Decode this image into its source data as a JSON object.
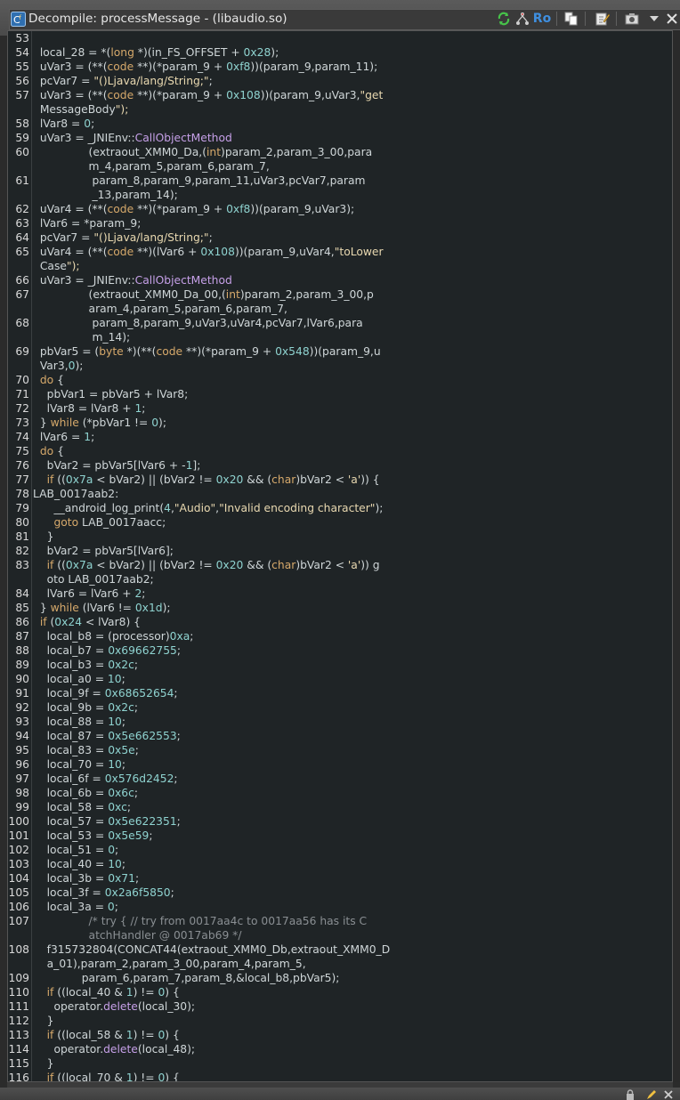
{
  "window": {
    "title": "Decompile: processMessage -  (libaudio.so)",
    "toolbar": {
      "ro_label": "Ro",
      "icons": [
        "refresh-icon",
        "graph-icon",
        "ro-toggle",
        "copy-icon",
        "edit-icon",
        "snapshot-icon",
        "dropdown-icon",
        "close-icon"
      ]
    }
  },
  "code": {
    "lines": [
      {
        "ln": "53",
        "text": ""
      },
      {
        "ln": "54",
        "text": "  local_28 = *(long *)(in_FS_OFFSET + 0x28);"
      },
      {
        "ln": "55",
        "text": "  uVar3 = (**(code **)(*param_9 + 0xf8))(param_9,param_11);"
      },
      {
        "ln": "56",
        "text": "  pcVar7 = \"()Ljava/lang/String;\";"
      },
      {
        "ln": "57",
        "text": "  uVar3 = (**(code **)(*param_9 + 0x108))(param_9,uVar3,\"get"
      },
      {
        "ln": "",
        "text": "  MessageBody\");"
      },
      {
        "ln": "58",
        "text": "  lVar8 = 0;"
      },
      {
        "ln": "59",
        "text": "  uVar3 = _JNIEnv::CallObjectMethod"
      },
      {
        "ln": "60",
        "text": "                (extraout_XMM0_Da,(int)param_2,param_3_00,para"
      },
      {
        "ln": "",
        "text": "                m_4,param_5,param_6,param_7,"
      },
      {
        "ln": "61",
        "text": "                 param_8,param_9,param_11,uVar3,pcVar7,param"
      },
      {
        "ln": "",
        "text": "                 _13,param_14);"
      },
      {
        "ln": "62",
        "text": "  uVar4 = (**(code **)(*param_9 + 0xf8))(param_9,uVar3);"
      },
      {
        "ln": "63",
        "text": "  lVar6 = *param_9;"
      },
      {
        "ln": "64",
        "text": "  pcVar7 = \"()Ljava/lang/String;\";"
      },
      {
        "ln": "65",
        "text": "  uVar4 = (**(code **)(lVar6 + 0x108))(param_9,uVar4,\"toLower"
      },
      {
        "ln": "",
        "text": "  Case\");"
      },
      {
        "ln": "66",
        "text": "  uVar3 = _JNIEnv::CallObjectMethod"
      },
      {
        "ln": "67",
        "text": "                (extraout_XMM0_Da_00,(int)param_2,param_3_00,p"
      },
      {
        "ln": "",
        "text": "                aram_4,param_5,param_6,param_7,"
      },
      {
        "ln": "68",
        "text": "                 param_8,param_9,uVar3,uVar4,pcVar7,lVar6,para"
      },
      {
        "ln": "",
        "text": "                 m_14);"
      },
      {
        "ln": "69",
        "text": "  pbVar5 = (byte *)(**(code **)(*param_9 + 0x548))(param_9,u"
      },
      {
        "ln": "",
        "text": "  Var3,0);"
      },
      {
        "ln": "70",
        "text": "  do {"
      },
      {
        "ln": "71",
        "text": "    pbVar1 = pbVar5 + lVar8;"
      },
      {
        "ln": "72",
        "text": "    lVar8 = lVar8 + 1;"
      },
      {
        "ln": "73",
        "text": "  } while (*pbVar1 != 0);"
      },
      {
        "ln": "74",
        "text": "  lVar6 = 1;"
      },
      {
        "ln": "75",
        "text": "  do {"
      },
      {
        "ln": "76",
        "text": "    bVar2 = pbVar5[lVar6 + -1];"
      },
      {
        "ln": "77",
        "text": "    if ((0x7a < bVar2) || (bVar2 != 0x20 && (char)bVar2 < 'a')) {"
      },
      {
        "ln": "78",
        "text": "LAB_0017aab2:"
      },
      {
        "ln": "79",
        "text": "      __android_log_print(4,\"Audio\",\"Invalid encoding character\");"
      },
      {
        "ln": "80",
        "text": "      goto LAB_0017aacc;"
      },
      {
        "ln": "81",
        "text": "    }"
      },
      {
        "ln": "82",
        "text": "    bVar2 = pbVar5[lVar6];"
      },
      {
        "ln": "83",
        "text": "    if ((0x7a < bVar2) || (bVar2 != 0x20 && (char)bVar2 < 'a')) g"
      },
      {
        "ln": "",
        "text": "    oto LAB_0017aab2;"
      },
      {
        "ln": "84",
        "text": "    lVar6 = lVar6 + 2;"
      },
      {
        "ln": "85",
        "text": "  } while (lVar6 != 0x1d);"
      },
      {
        "ln": "86",
        "text": "  if (0x24 < lVar8) {"
      },
      {
        "ln": "87",
        "text": "    local_b8 = (processor)0xa;"
      },
      {
        "ln": "88",
        "text": "    local_b7 = 0x69662755;"
      },
      {
        "ln": "89",
        "text": "    local_b3 = 0x2c;"
      },
      {
        "ln": "90",
        "text": "    local_a0 = 10;"
      },
      {
        "ln": "91",
        "text": "    local_9f = 0x68652654;"
      },
      {
        "ln": "92",
        "text": "    local_9b = 0x2c;"
      },
      {
        "ln": "93",
        "text": "    local_88 = 10;"
      },
      {
        "ln": "94",
        "text": "    local_87 = 0x5e662553;"
      },
      {
        "ln": "95",
        "text": "    local_83 = 0x5e;"
      },
      {
        "ln": "96",
        "text": "    local_70 = 10;"
      },
      {
        "ln": "97",
        "text": "    local_6f = 0x576d2452;"
      },
      {
        "ln": "98",
        "text": "    local_6b = 0x6c;"
      },
      {
        "ln": "99",
        "text": "    local_58 = 0xc;"
      },
      {
        "ln": "100",
        "text": "    local_57 = 0x5e622351;"
      },
      {
        "ln": "101",
        "text": "    local_53 = 0x5e59;"
      },
      {
        "ln": "102",
        "text": "    local_51 = 0;"
      },
      {
        "ln": "103",
        "text": "    local_40 = 10;"
      },
      {
        "ln": "104",
        "text": "    local_3b = 0x71;"
      },
      {
        "ln": "105",
        "text": "    local_3f = 0x2a6f5850;"
      },
      {
        "ln": "106",
        "text": "    local_3a = 0;"
      },
      {
        "ln": "107",
        "text": "                /* try { // try from 0017aa4c to 0017aa56 has its C"
      },
      {
        "ln": "",
        "text": "                atchHandler @ 0017ab69 */"
      },
      {
        "ln": "108",
        "text": "    f315732804(CONCAT44(extraout_XMM0_Db,extraout_XMM0_D"
      },
      {
        "ln": "",
        "text": "    a_01),param_2,param_3_00,param_4,param_5,"
      },
      {
        "ln": "109",
        "text": "              param_6,param_7,param_8,&local_b8,pbVar5);"
      },
      {
        "ln": "110",
        "text": "    if ((local_40 & 1) != 0) {"
      },
      {
        "ln": "111",
        "text": "      operator.delete(local_30);"
      },
      {
        "ln": "112",
        "text": "    }"
      },
      {
        "ln": "113",
        "text": "    if ((local_58 & 1) != 0) {"
      },
      {
        "ln": "114",
        "text": "      operator.delete(local_48);"
      },
      {
        "ln": "115",
        "text": "    }"
      },
      {
        "ln": "116",
        "text": "    if ((local_70 & 1) != 0) {"
      }
    ]
  },
  "colors": {
    "background": "#1f2426",
    "text": "#cfd6d8",
    "keyword": "#d6a96b",
    "number": "#8fd3d0",
    "string": "#e8d8b0",
    "function": "#c6a0e8",
    "comment": "#8a8f93"
  }
}
